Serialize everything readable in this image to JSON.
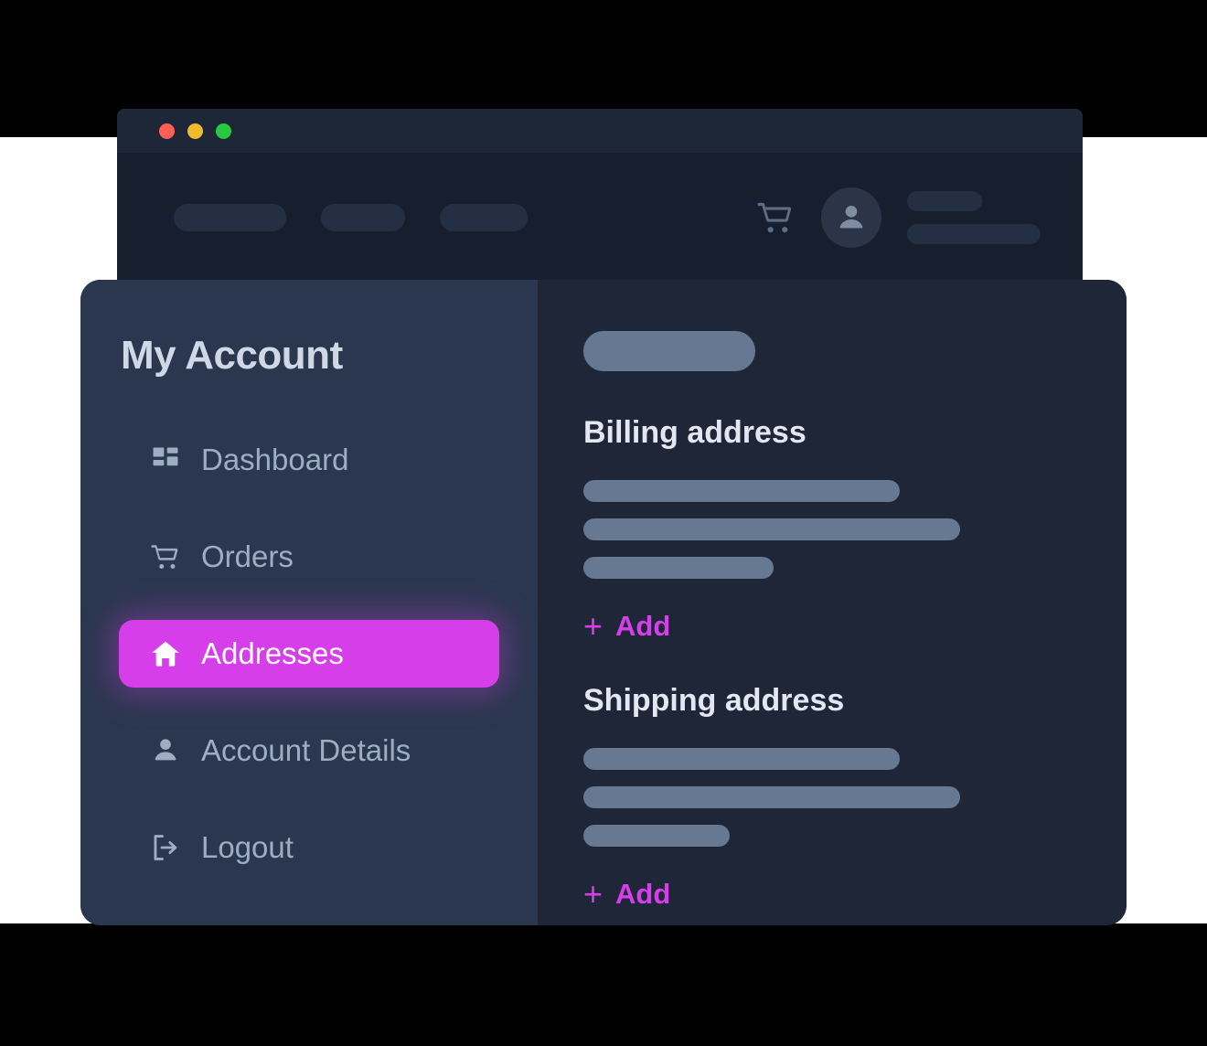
{
  "window": {
    "traffic_lights": [
      "close",
      "minimize",
      "maximize"
    ],
    "colors": {
      "close": "#ff5f57",
      "minimize": "#f0bc2e",
      "maximize": "#28c840"
    },
    "nav_placeholders": [
      "",
      "",
      ""
    ],
    "cart_icon": "shopping-cart-icon",
    "avatar_icon": "person-icon",
    "user_placeholders": [
      "",
      ""
    ]
  },
  "sidebar": {
    "title": "My Account",
    "items": [
      {
        "label": "Dashboard",
        "icon": "dashboard-grid-icon",
        "active": false
      },
      {
        "label": "Orders",
        "icon": "shopping-cart-icon",
        "active": false
      },
      {
        "label": "Addresses",
        "icon": "home-icon",
        "active": true
      },
      {
        "label": "Account Details",
        "icon": "person-icon",
        "active": false
      },
      {
        "label": "Logout",
        "icon": "logout-icon",
        "active": false
      }
    ]
  },
  "main": {
    "header_placeholder": "",
    "sections": [
      {
        "title": "Billing address",
        "placeholder_lines": [
          "",
          "",
          ""
        ],
        "add_label": "Add",
        "add_plus": "+"
      },
      {
        "title": "Shipping address",
        "placeholder_lines": [
          "",
          "",
          ""
        ],
        "add_label": "Add",
        "add_plus": "+"
      }
    ]
  },
  "theme": {
    "accent": "#d53ee8",
    "sidebar_bg": "#2b374f",
    "panel_bg": "#1e2637",
    "nav_bg": "#171f2e",
    "titlebar_bg": "#1d2738",
    "skeleton": "#667892",
    "text_muted": "#9fadc2",
    "text_bright": "#e2e8f2"
  }
}
